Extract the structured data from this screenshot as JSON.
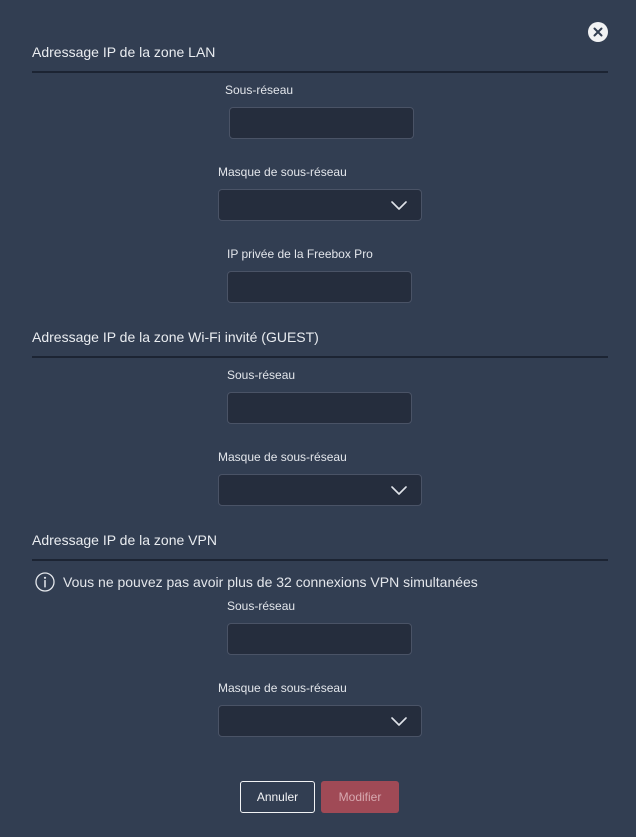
{
  "dialog": {
    "close_label": "×"
  },
  "sections": {
    "lan": {
      "title": "Adressage IP de la zone LAN",
      "subnet_label": "Sous-réseau",
      "subnet_value": "",
      "mask_label": "Masque de sous-réseau",
      "mask_value": "",
      "private_ip_label": "IP privée de la Freebox Pro",
      "private_ip_value": ""
    },
    "guest": {
      "title": "Adressage IP de la zone Wi-Fi invité (GUEST)",
      "subnet_label": "Sous-réseau",
      "subnet_value": "",
      "mask_label": "Masque de sous-réseau",
      "mask_value": ""
    },
    "vpn": {
      "title": "Adressage IP de la zone VPN",
      "info_text": "Vous ne pouvez pas avoir plus de 32 connexions VPN simultanées",
      "subnet_label": "Sous-réseau",
      "subnet_value": "",
      "mask_label": "Masque de sous-réseau",
      "mask_value": ""
    }
  },
  "actions": {
    "cancel_label": "Annuler",
    "submit_label": "Modifier"
  },
  "colors": {
    "background": "#323e52",
    "input_background": "#252d3d",
    "submit_disabled": "#a04a56"
  },
  "icons": {
    "close": "close-icon",
    "dropdown": "chevron-down-icon",
    "info": "info-icon"
  }
}
